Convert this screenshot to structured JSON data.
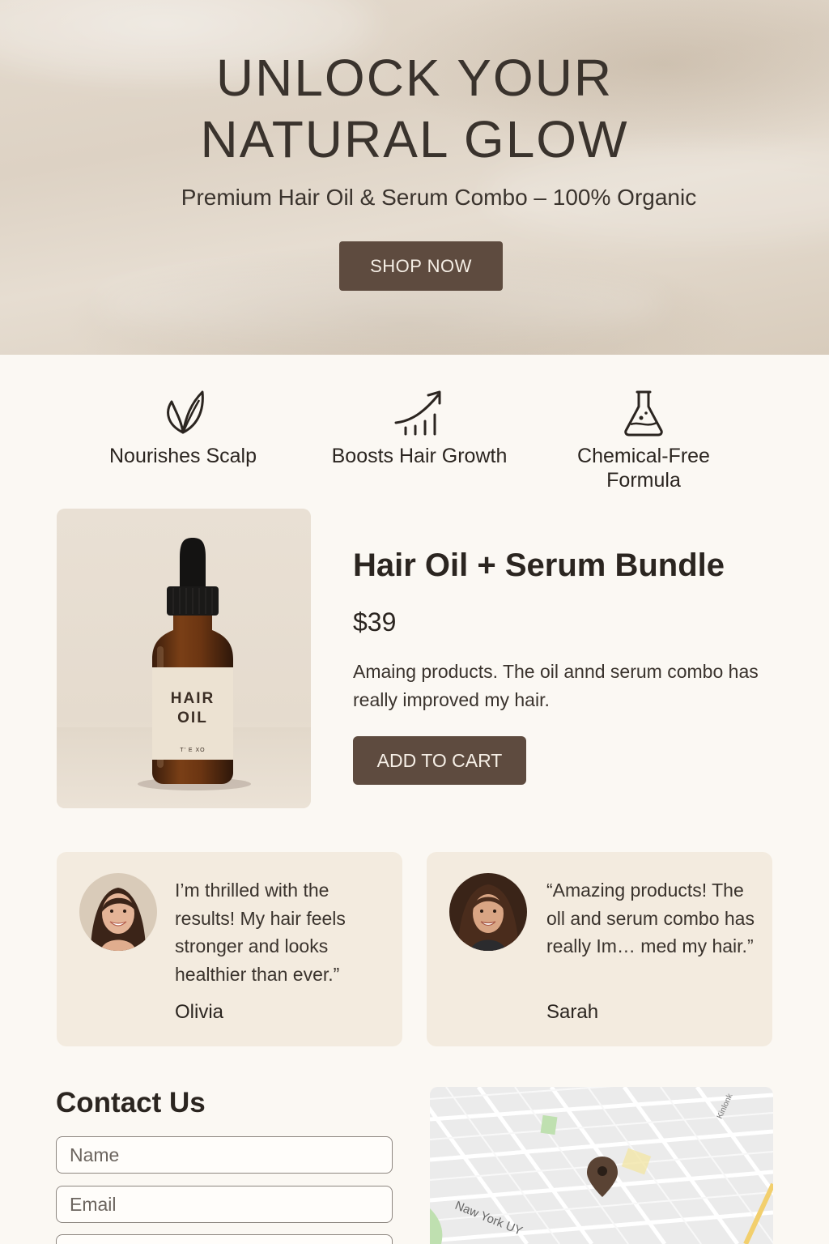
{
  "hero": {
    "title": "UNLOCK YOUR\nNATURAL GLOW",
    "subtitle": "Premium Hair Oil & Serum Combo – 100% Organic",
    "cta_label": "SHOP NOW"
  },
  "features": [
    {
      "icon": "leaf-icon",
      "label": "Nourishes Scalp"
    },
    {
      "icon": "growth-chart-icon",
      "label": "Boosts Hair Growth"
    },
    {
      "icon": "flask-icon",
      "label": "Chemical-Free\nFormula"
    }
  ],
  "product": {
    "bottle_label": "HAIR\nOIL",
    "bottle_small_text": "T' E XO",
    "title": "Hair Oil + Serum Bundle",
    "price": "$39",
    "description": "Amaing products. The oil annd serum combo has really improved my hair.",
    "cta_label": "ADD TO CART"
  },
  "testimonials": [
    {
      "quote": "I’m thrilled with the results! My hair feels stronger and looks healthier than ever.”",
      "author": "Olivia"
    },
    {
      "quote": "“Amazing products! The oll and serum combo has really Im… med my hair.”",
      "author": "Sarah"
    }
  ],
  "contact": {
    "title": "Contact Us",
    "name_placeholder": "Name",
    "email_placeholder": "Email"
  },
  "map": {
    "street_label": "Naw York UY",
    "corner_label": "Kinlonk"
  },
  "colors": {
    "accent": "#5e4b3f",
    "page_bg": "#fbf8f3",
    "card_bg": "#f3ebdf",
    "text": "#2b2520"
  }
}
